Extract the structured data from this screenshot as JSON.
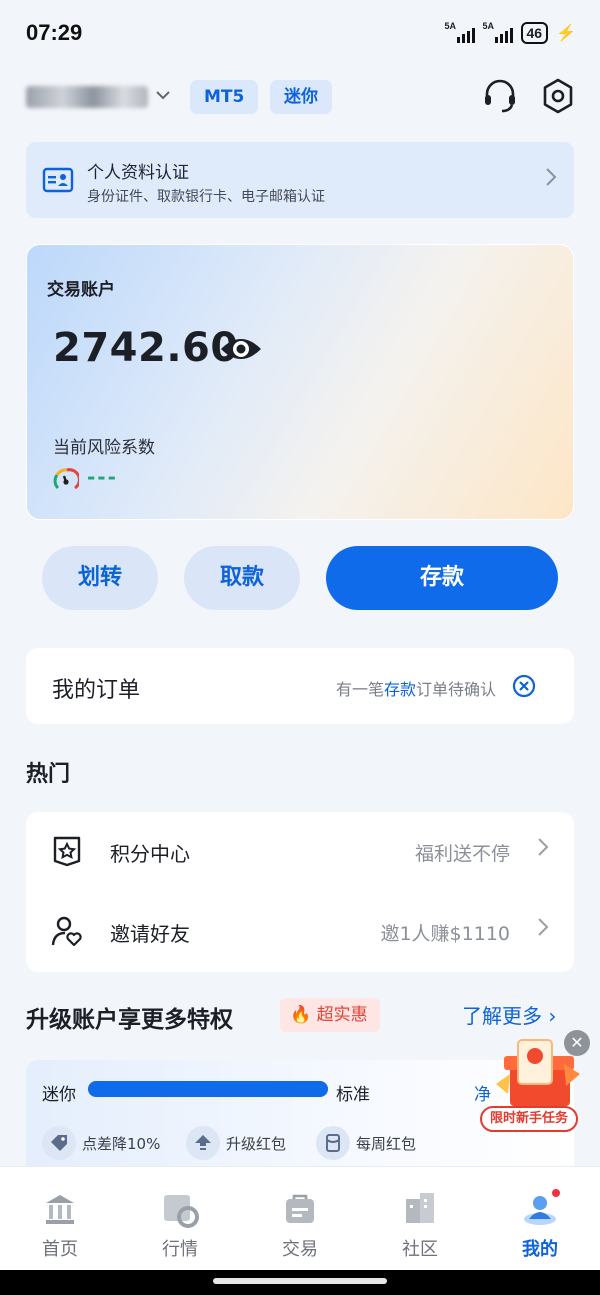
{
  "status_bar": {
    "time": "07:29",
    "signal_1": "5A",
    "signal_2": "5A",
    "battery": "46"
  },
  "header": {
    "platform_tag": "MT5",
    "account_type_tag": "迷你"
  },
  "verify": {
    "title": "个人资料认证",
    "subtitle": "身份证件、取款银行卡、电子邮箱认证"
  },
  "trading_account": {
    "label": "交易账户",
    "balance": "2742.60",
    "risk_label": "当前风险系数",
    "risk_value": "---"
  },
  "actions": {
    "transfer": "划转",
    "withdraw": "取款",
    "deposit": "存款"
  },
  "orders": {
    "title": "我的订单",
    "note_prefix": "有一笔",
    "note_highlight": "存款",
    "note_suffix": "订单待确认"
  },
  "hot": {
    "title": "热门",
    "items": [
      {
        "label": "积分中心",
        "value": "福利送不停"
      },
      {
        "label": "邀请好友",
        "value": "邀1人赚$1110"
      }
    ]
  },
  "upgrade": {
    "title": "升级账户享更多特权",
    "badge": "超实惠",
    "learn_more": "了解更多",
    "level_from": "迷你",
    "level_to": "标准",
    "level_next": "净",
    "progress": 1.0,
    "perks": [
      "点差降10%",
      "升级红包",
      "每周红包"
    ]
  },
  "promo": {
    "label": "限时新手任务"
  },
  "tabs": [
    {
      "label": "首页",
      "icon": "bank-icon"
    },
    {
      "label": "行情",
      "icon": "chart-icon"
    },
    {
      "label": "交易",
      "icon": "briefcase-icon"
    },
    {
      "label": "社区",
      "icon": "buildings-icon"
    },
    {
      "label": "我的",
      "icon": "profile-icon",
      "active": true
    }
  ],
  "colors": {
    "accent": "#0f6bea",
    "accent_text": "#0d63d8",
    "hot_red": "#e8433a",
    "risk_green": "#1aaa6f"
  }
}
